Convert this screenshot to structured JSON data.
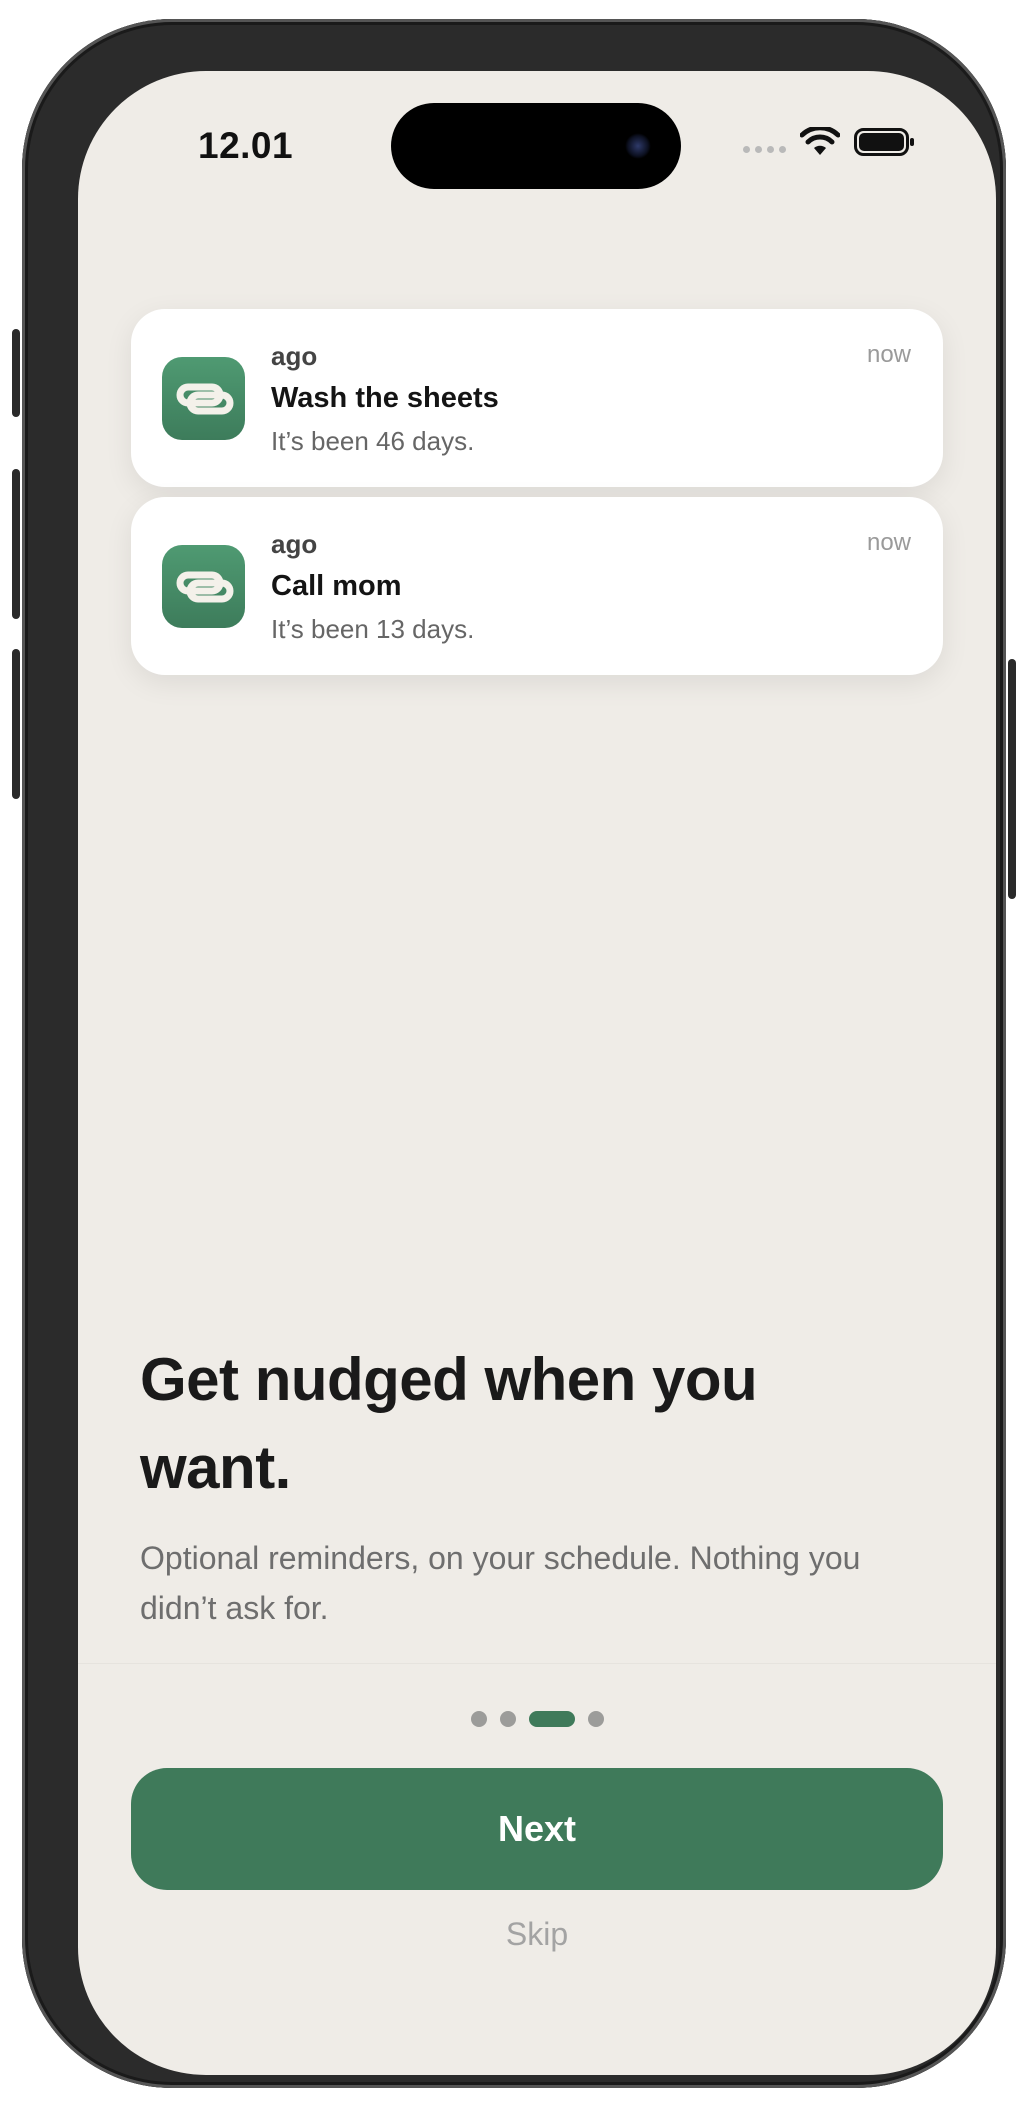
{
  "status_bar": {
    "time": "12.01"
  },
  "notifications": [
    {
      "app": "ago",
      "time": "now",
      "title": "Wash the sheets",
      "body": "It’s been 46 days."
    },
    {
      "app": "ago",
      "time": "now",
      "title": "Call mom",
      "body": "It’s been 13 days."
    }
  ],
  "onboarding": {
    "headline": "Get nudged when you want.",
    "subtext": "Optional reminders, on your schedule. Nothing you didn’t ask for.",
    "page_indicator": {
      "total": 4,
      "current": 3
    },
    "next_label": "Next",
    "skip_label": "Skip"
  },
  "colors": {
    "accent": "#3f7a5a",
    "background": "#efece7",
    "icon_green": "#4a9069"
  },
  "icons": {
    "app_icon": "chain-link-icon",
    "signal": "cellular-signal-icon",
    "wifi": "wifi-icon",
    "battery": "battery-icon"
  }
}
